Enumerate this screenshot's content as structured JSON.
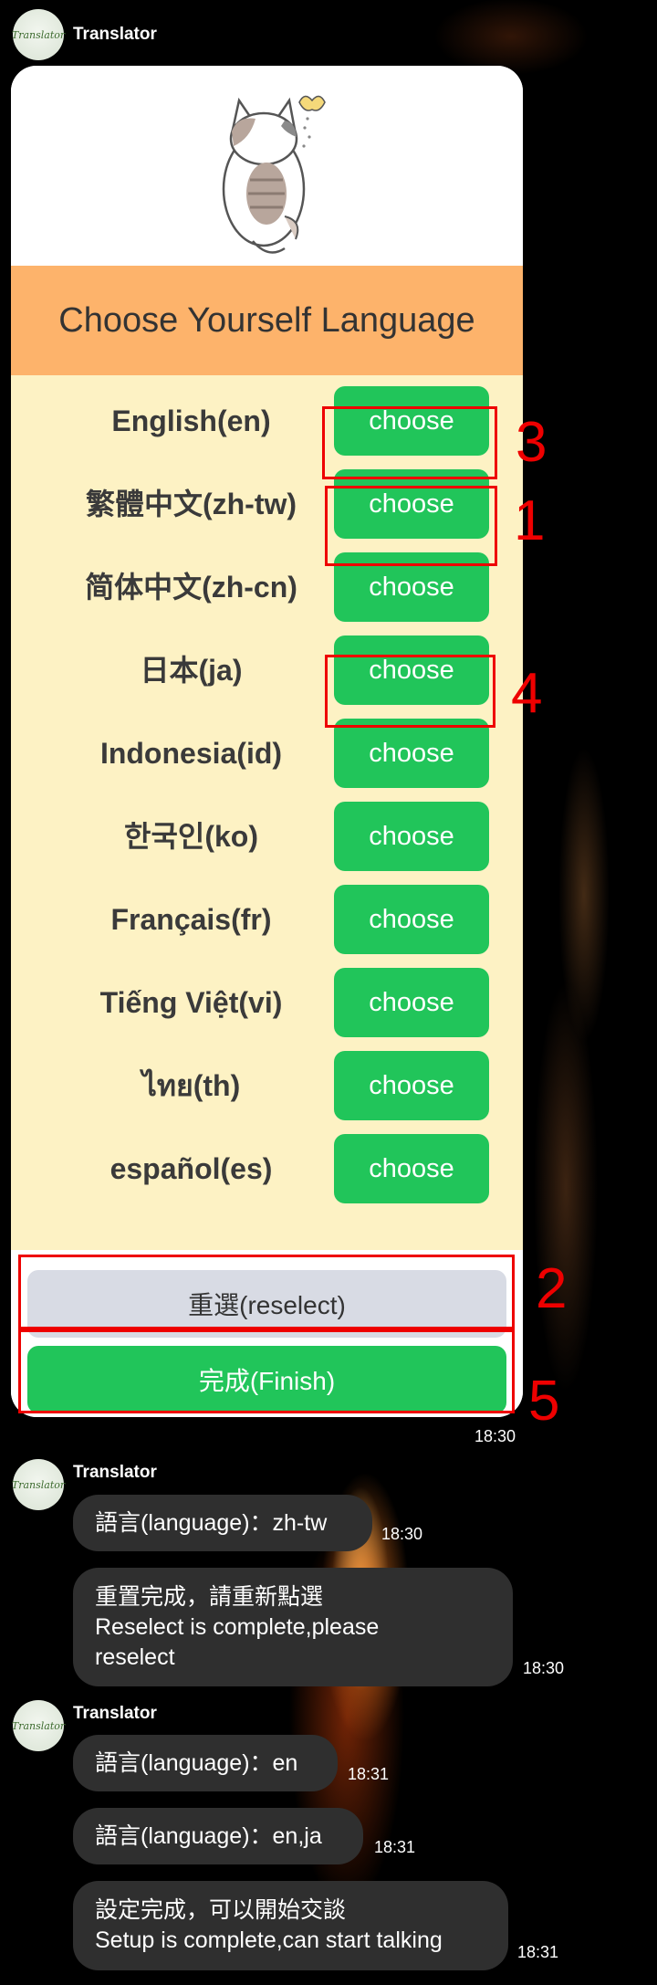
{
  "bot": {
    "name": "Translator",
    "avatar_text": "Translator"
  },
  "card": {
    "title": "Choose Yourself Language",
    "languages": [
      {
        "label": "English(en)",
        "button": "choose"
      },
      {
        "label": "繁體中文(zh-tw)",
        "button": "choose"
      },
      {
        "label": "简体中文(zh-cn)",
        "button": "choose"
      },
      {
        "label": "日本(ja)",
        "button": "choose"
      },
      {
        "label": "Indonesia(id)",
        "button": "choose"
      },
      {
        "label": "한국인(ko)",
        "button": "choose"
      },
      {
        "label": "Français(fr)",
        "button": "choose"
      },
      {
        "label": "Tiếng Việt(vi)",
        "button": "choose"
      },
      {
        "label": "ไทย(th)",
        "button": "choose"
      },
      {
        "label": "español(es)",
        "button": "choose"
      }
    ],
    "reselect_label": "重選(reselect)",
    "finish_label": "完成(Finish)",
    "time": "18:30"
  },
  "annotations": {
    "mark_1": "1",
    "mark_2": "2",
    "mark_3": "3",
    "mark_4": "4",
    "mark_5": "5"
  },
  "messages": [
    {
      "text": "語言(language)：zh-tw",
      "time": "18:30"
    },
    {
      "line1": "重置完成，請重新點選",
      "line2": "Reselect is complete,please",
      "line3": "reselect",
      "time": "18:30"
    },
    {
      "text": "語言(language)：en",
      "time": "18:31"
    },
    {
      "text": "語言(language)：en,ja",
      "time": "18:31"
    },
    {
      "line1": "設定完成，可以開始交談",
      "line2": "Setup is complete,can start talking",
      "time": "18:31"
    }
  ],
  "colors": {
    "accent_green": "#21c55a",
    "title_orange": "#fdb36b",
    "panel_cream": "#fdf2c4",
    "annotation_red": "#e00000"
  }
}
